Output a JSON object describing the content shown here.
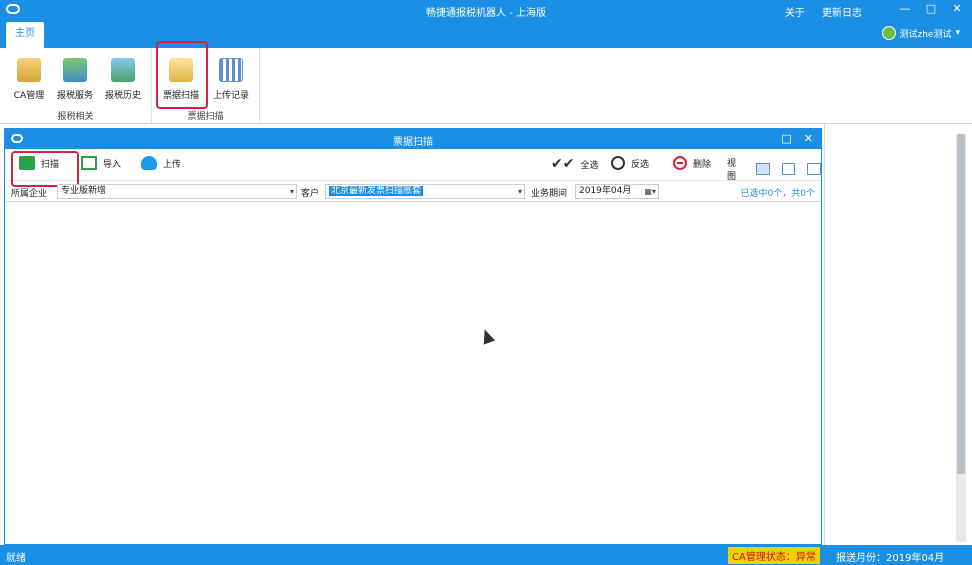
{
  "app": {
    "title": "畅捷通报税机器人 - 上海版",
    "links": [
      "关于",
      "更新日志"
    ],
    "win": [
      "—",
      "□",
      "✕"
    ]
  },
  "tabs": {
    "home": "主页"
  },
  "user": {
    "name": "测试zhe测试"
  },
  "ribbon": {
    "group1": {
      "label": "报税相关",
      "items": [
        "CA管理",
        "报税服务",
        "报税历史"
      ]
    },
    "group2": {
      "label": "票据扫描",
      "items": [
        "票据扫描",
        "上传记录"
      ]
    }
  },
  "child": {
    "title": "票据扫描",
    "win": [
      "□",
      "✕"
    ],
    "toolbar": {
      "scan": "扫描",
      "import": "导入",
      "upload": "上传",
      "select_all": "全选",
      "invert": "反选",
      "delete": "删除",
      "view": "视图"
    },
    "filter": {
      "company_label": "所属企业",
      "company_value": "专业版新增",
      "customer_label": "客户",
      "customer_value": "北京最新发票扫描账套",
      "period_label": "业务期间",
      "period_value": "2019年04月",
      "summary": "已选中0个，共0个"
    }
  },
  "status": {
    "ready": "就绪",
    "ca_status": "CA管理状态：异常",
    "month": "报送月份：2019年04月"
  }
}
